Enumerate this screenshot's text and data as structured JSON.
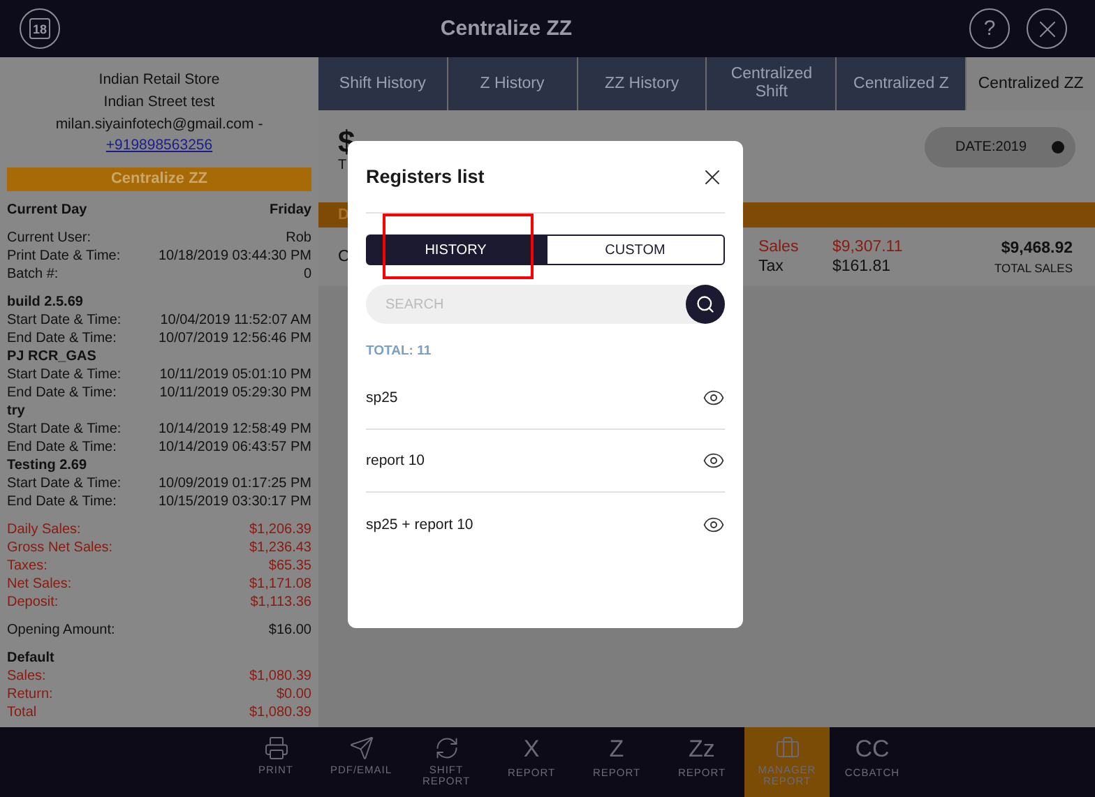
{
  "header": {
    "title": "Centralize ZZ",
    "calendar_day": "18",
    "help": "?"
  },
  "tabs": [
    {
      "label": "Shift History",
      "selected": false
    },
    {
      "label": "Z History",
      "selected": false
    },
    {
      "label": "ZZ History",
      "selected": false
    },
    {
      "label": "Centralized Shift",
      "selected": false
    },
    {
      "label": "Centralized Z",
      "selected": false
    },
    {
      "label": "Centralized ZZ",
      "selected": true
    }
  ],
  "sidebar": {
    "store_lines": [
      "Indian Retail Store",
      "Indian Street test",
      "milan.siyainfotech@gmail.com -"
    ],
    "phone": "+919898563256",
    "banner": "Centralize ZZ",
    "groups": [
      [
        {
          "kind": "bold",
          "label": "Current Day",
          "value": "Friday"
        }
      ],
      [
        {
          "kind": "plain",
          "label": "Current User:",
          "value": "Rob"
        },
        {
          "kind": "plain",
          "label": "Print Date & Time:",
          "value": "10/18/2019 03:44:30 PM"
        },
        {
          "kind": "plain",
          "label": "Batch #:",
          "value": "0"
        }
      ],
      [
        {
          "kind": "bold",
          "label": "build 2.5.69"
        },
        {
          "kind": "plain",
          "label": "Start Date & Time:",
          "value": "10/04/2019 11:52:07 AM"
        },
        {
          "kind": "plain",
          "label": "End Date & Time:",
          "value": "10/07/2019 12:56:46 PM"
        },
        {
          "kind": "bold",
          "label": "PJ RCR_GAS"
        },
        {
          "kind": "plain",
          "label": "Start Date & Time:",
          "value": "10/11/2019 05:01:10 PM"
        },
        {
          "kind": "plain",
          "label": "End Date & Time:",
          "value": "10/11/2019 05:29:30 PM"
        },
        {
          "kind": "bold",
          "label": "try"
        },
        {
          "kind": "plain",
          "label": "Start Date & Time:",
          "value": "10/14/2019 12:58:49 PM"
        },
        {
          "kind": "plain",
          "label": "End Date & Time:",
          "value": "10/14/2019 06:43:57 PM"
        },
        {
          "kind": "bold",
          "label": "Testing 2.69"
        },
        {
          "kind": "plain",
          "label": "Start Date & Time:",
          "value": "10/09/2019 01:17:25 PM"
        },
        {
          "kind": "plain",
          "label": "End Date & Time:",
          "value": "10/15/2019 03:30:17 PM"
        }
      ],
      [
        {
          "kind": "red",
          "label": "Daily Sales:",
          "value": "$1,206.39"
        },
        {
          "kind": "red",
          "label": "Gross Net Sales:",
          "value": "$1,236.43"
        },
        {
          "kind": "red",
          "label": "Taxes:",
          "value": "$65.35"
        },
        {
          "kind": "red",
          "label": "Net Sales:",
          "value": "$1,171.08"
        },
        {
          "kind": "red",
          "label": "Deposit:",
          "value": "$1,113.36"
        }
      ],
      [
        {
          "kind": "plain",
          "label": "Opening Amount:",
          "value": "$16.00"
        }
      ],
      [
        {
          "kind": "bold",
          "label": "Default"
        },
        {
          "kind": "red",
          "label": "Sales:",
          "value": "$1,080.39"
        },
        {
          "kind": "red",
          "label": "Return:",
          "value": "$0.00"
        },
        {
          "kind": "red",
          "label": "Total",
          "value": "$1,080.39"
        }
      ]
    ]
  },
  "main": {
    "amount_partial": "$",
    "subtitle_partial": "T",
    "band_partial": "D",
    "row_partial": "C",
    "date": "DATE:2019",
    "sales_label": "Sales",
    "sales_value": "$9,307.11",
    "tax_label": "Tax",
    "tax_value": "$161.81",
    "total_value": "$9,468.92",
    "total_label": "TOTAL SALES"
  },
  "modal": {
    "title": "Registers list",
    "segments": [
      {
        "label": "HISTORY",
        "selected": true
      },
      {
        "label": "CUSTOM",
        "selected": false
      }
    ],
    "search": {
      "placeholder": "SEARCH"
    },
    "total": "TOTAL: 11",
    "items": [
      "sp25",
      "report 10",
      "sp25 + report 10"
    ]
  },
  "toolbar": [
    {
      "kind": "printer",
      "label": "PRINT",
      "selected": false
    },
    {
      "kind": "send",
      "label": "PDF/EMAIL",
      "selected": false
    },
    {
      "kind": "cycle",
      "label": "SHIFT REPORT",
      "selected": false
    },
    {
      "kind": "glyph",
      "glyph": "X",
      "label": "REPORT",
      "selected": false
    },
    {
      "kind": "glyph",
      "glyph": "Z",
      "label": "REPORT",
      "selected": false
    },
    {
      "kind": "glyph",
      "glyph": "Zz",
      "label": "REPORT",
      "selected": false
    },
    {
      "kind": "briefcase",
      "label": "MANAGER REPORT",
      "selected": true
    },
    {
      "kind": "glyph",
      "glyph": "CC",
      "label": "CCBATCH",
      "selected": false
    }
  ]
}
